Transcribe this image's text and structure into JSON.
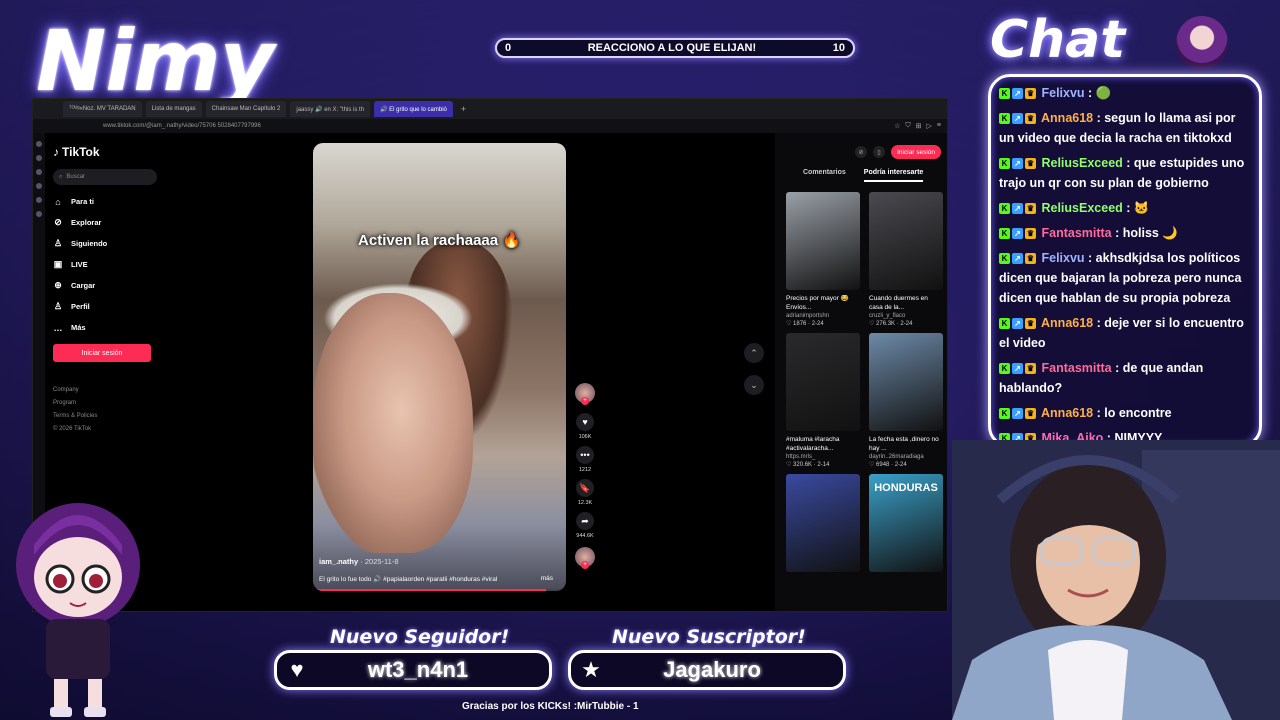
{
  "overlay": {
    "logo": "Nimy",
    "chat_title": "Chat",
    "goal": {
      "start": "0",
      "label": "REACCIONO A LO QUE ELIJAN!",
      "end": "10"
    },
    "follower_title": "Nuevo Seguidor!",
    "follower_name": "wt3_n4n1",
    "subscriber_title": "Nuevo Suscriptor!",
    "subscriber_name": "Jagakuro",
    "footnote": "Gracias por los KICKs! :MirTubbie - 1"
  },
  "browser": {
    "tabs": [
      {
        "label": "ᵀᴼᵁᵍ«Noz. MV TARADAN",
        "active": false
      },
      {
        "label": "Lista de mangas",
        "active": false
      },
      {
        "label": "Chainsaw Man Capítulo 2",
        "active": false
      },
      {
        "label": "jaassy 🔊 en X: \"this is th",
        "active": false
      },
      {
        "label": "🔊 El grito que lo cambió",
        "active": true
      }
    ],
    "url": "www.tiktok.com/@iam_.nathy/video/75706 5028407797996"
  },
  "tiktok": {
    "brand": "TikTok",
    "search_placeholder": "Buscar",
    "nav": [
      {
        "icon": "⌂",
        "label": "Para ti"
      },
      {
        "icon": "⊘",
        "label": "Explorar"
      },
      {
        "icon": "♙",
        "label": "Siguiendo"
      },
      {
        "icon": "▣",
        "label": "LIVE"
      },
      {
        "icon": "⊕",
        "label": "Cargar"
      },
      {
        "icon": "♙",
        "label": "Perfil"
      },
      {
        "icon": "…",
        "label": "Más"
      }
    ],
    "login": "Iniciar sesión",
    "footer": [
      "Company",
      "Program",
      "Terms & Policies",
      "© 2026 TikTok"
    ],
    "video": {
      "caption": "Activen la rachaaaa 🔥",
      "user": "iam_.nathy",
      "date": "· 2025-11-8",
      "description": "El grito lo fue todo 🔊 #papialaorden #paratii #honduras #viral",
      "more": "más"
    },
    "actions": [
      {
        "icon": "♥",
        "count": "106K"
      },
      {
        "icon": "•••",
        "count": "1212"
      },
      {
        "icon": "🔖",
        "count": "12.3K"
      },
      {
        "icon": "➦",
        "count": "944.6K"
      }
    ],
    "right_panel": {
      "login": "Iniciar sesión",
      "tab_comments": "Comentarios",
      "tab_interesting": "Podría interesarte",
      "cards": [
        {
          "title": "Precios por mayor 😂 Envíos...",
          "user": "adrianimportshn",
          "stats": "♡ 1876 · 2-24",
          "color": "#9aa0a8"
        },
        {
          "title": "Cuando duermes en casa de la...",
          "user": "cruzli_y_flaco",
          "stats": "♡ 276.3K · 2-24",
          "color": "#4a4a50"
        },
        {
          "title": "#maluma #laracha #activalaracha...",
          "user": "https.mrls_",
          "stats": "♡ 320.6K · 2-14",
          "color": "#2a2a2c"
        },
        {
          "title": "La fecha esta ,dinero no hay ...",
          "user": "dayrin..26maradiaga",
          "stats": "♡ 6948 · 2-24",
          "color": "#6d8aa8"
        },
        {
          "title": "",
          "user": "",
          "stats": "",
          "color": "#3a4aa0"
        },
        {
          "title": "HONDURAS",
          "user": "",
          "stats": "",
          "color": "#3aa0c8"
        }
      ]
    }
  },
  "chat": [
    {
      "user": "Felixvu",
      "color": "#9fb3ff",
      "text": "🟢"
    },
    {
      "user": "Anna618",
      "color": "#ffb04a",
      "text": "segun lo llama asi por un video que decia la racha en tiktokxd"
    },
    {
      "user": "ReliusExceed",
      "color": "#8fff6a",
      "text": "que estupides uno trajo un qr con su plan de gobierno"
    },
    {
      "user": "ReliusExceed",
      "color": "#8fff6a",
      "text": "🐱"
    },
    {
      "user": "Fantasmitta",
      "color": "#ff6a9a",
      "text": "holiss 🌙"
    },
    {
      "user": "Felixvu",
      "color": "#9fb3ff",
      "text": "akhsdkjdsa los políticos dicen que bajaran la pobreza pero nunca dicen que hablan de su propia pobreza"
    },
    {
      "user": "Anna618",
      "color": "#ffb04a",
      "text": "deje ver si lo encuentro el video"
    },
    {
      "user": "Fantasmitta",
      "color": "#ff6a9a",
      "text": "de que andan hablando?"
    },
    {
      "user": "Anna618",
      "color": "#ffb04a",
      "text": "lo encontre"
    },
    {
      "user": "Mika_Aiko",
      "color": "#ff6ab0",
      "text": "NIMYYY"
    }
  ]
}
